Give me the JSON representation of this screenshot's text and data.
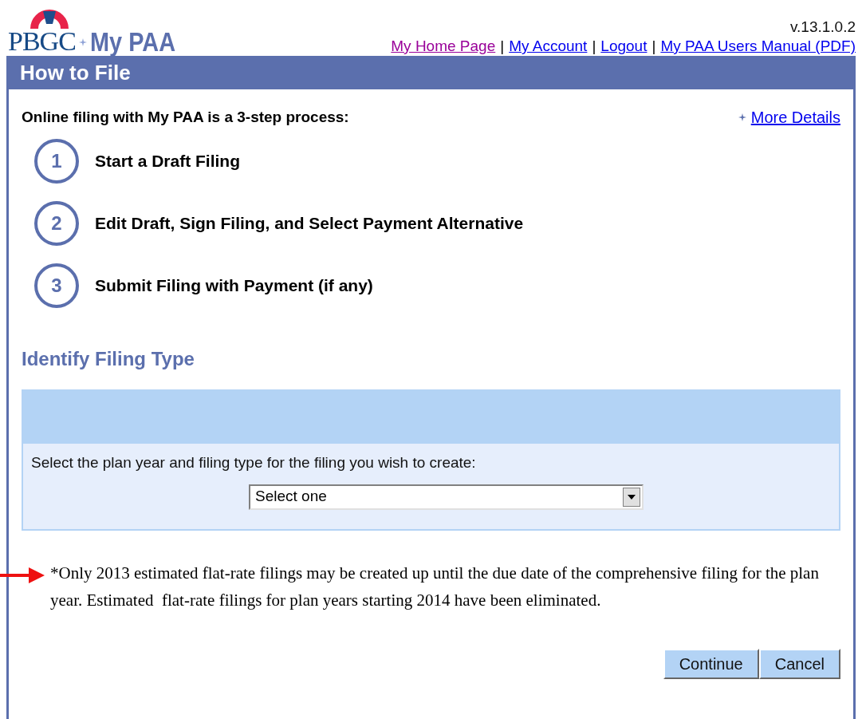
{
  "logo": {
    "org": "PBGC",
    "product": "My PAA"
  },
  "version": "v.13.1.0.2",
  "nav_links": [
    {
      "label": "My Home Page",
      "visited": true
    },
    {
      "label": "My Account",
      "visited": false
    },
    {
      "label": "Logout",
      "visited": false
    },
    {
      "label": "My PAA Users Manual (PDF)",
      "visited": false
    }
  ],
  "nav_separator": "|",
  "page_title": "How to File",
  "intro": "Online filing with My PAA is a 3-step process:",
  "more_details": "More Details",
  "steps": [
    {
      "number": "1",
      "label": "Start a Draft Filing"
    },
    {
      "number": "2",
      "label": "Edit Draft, Sign Filing, and Select Payment Alternative"
    },
    {
      "number": "3",
      "label": "Submit Filing with Payment (if any)"
    }
  ],
  "section_title": "Identify Filing Type",
  "select_prompt": "Select the plan year and filing type for the filing you wish to create:",
  "select_value": "Select one",
  "note": "*Only 2013 estimated flat-rate filings may be created up until the due date of the comprehensive filing for the plan year. Estimated  flat-rate filings for plan years starting 2014 have been eliminated.",
  "buttons": [
    "Continue",
    "Cancel"
  ]
}
